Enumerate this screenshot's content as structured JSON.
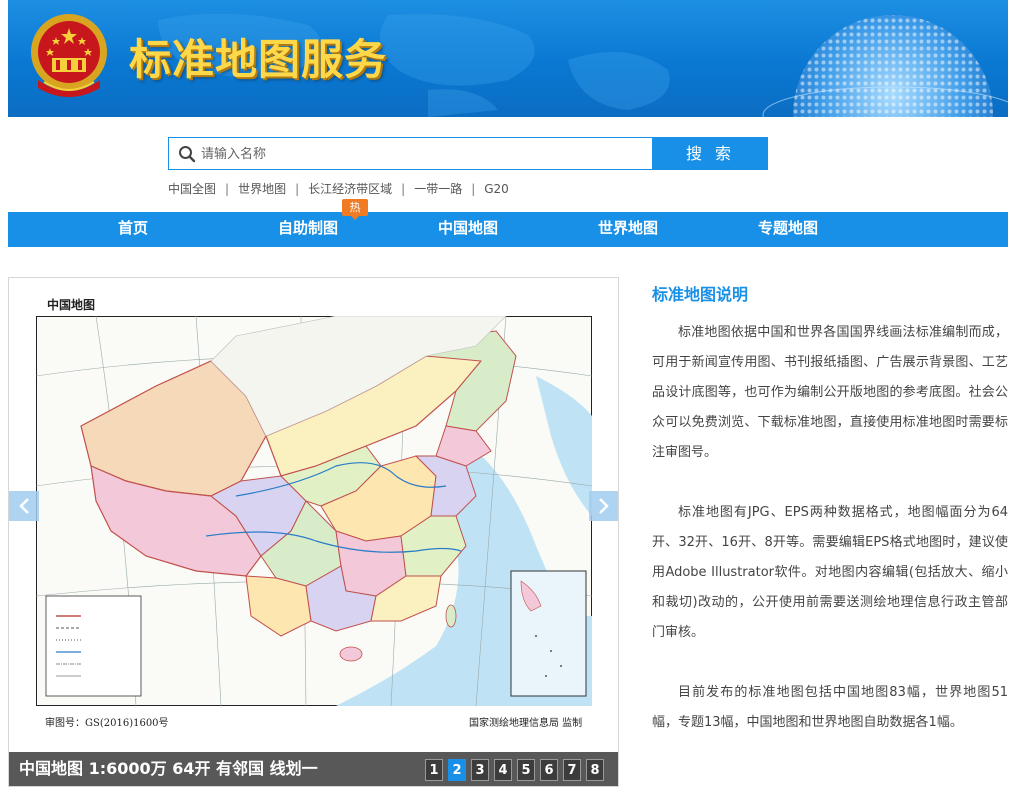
{
  "banner": {
    "title": "标准地图服务"
  },
  "search": {
    "placeholder": "请输入名称",
    "button_label": "搜 索"
  },
  "quick_links": [
    "中国全图",
    "世界地图",
    "长江经济带区域",
    "一带一路",
    "G20"
  ],
  "nav": {
    "items": [
      "首页",
      "自助制图",
      "中国地图",
      "世界地图",
      "专题地图"
    ],
    "hot_badge": "热"
  },
  "slider": {
    "map_title": "中国地图",
    "approval_number": "审图号：GS(2016)1600号",
    "publisher": "国家测绘地理信息局  监制",
    "caption": "中国地图 1:6000万 64开 有邻国 线划一",
    "pages": [
      "1",
      "2",
      "3",
      "4",
      "5",
      "6",
      "7",
      "8"
    ],
    "active_page": "2"
  },
  "description": {
    "title": "标准地图说明",
    "paragraphs": [
      "标准地图依据中国和世界各国国界线画法标准编制而成，可用于新闻宣传用图、书刊报纸插图、广告展示背景图、工艺品设计底图等，也可作为编制公开版地图的参考底图。社会公众可以免费浏览、下载标准地图，直接使用标准地图时需要标注审图号。",
      "标准地图有JPG、EPS两种数据格式，地图幅面分为64开、32开、16开、8开等。需要编辑EPS格式地图时，建议使用Adobe Illustrator软件。对地图内容编辑(包括放大、缩小和裁切)改动的，公开使用前需要送测绘地理信息行政主管部门审核。",
      "目前发布的标准地图包括中国地图83幅，世界地图51幅，专题13幅，中国地图和世界地图自助数据各1幅。"
    ]
  },
  "colors": {
    "primary_blue": "#1890e8",
    "banner_title_gold": "#ffd84a",
    "hot_badge_orange": "#f07b22",
    "caption_bar_gray": "#585858"
  }
}
